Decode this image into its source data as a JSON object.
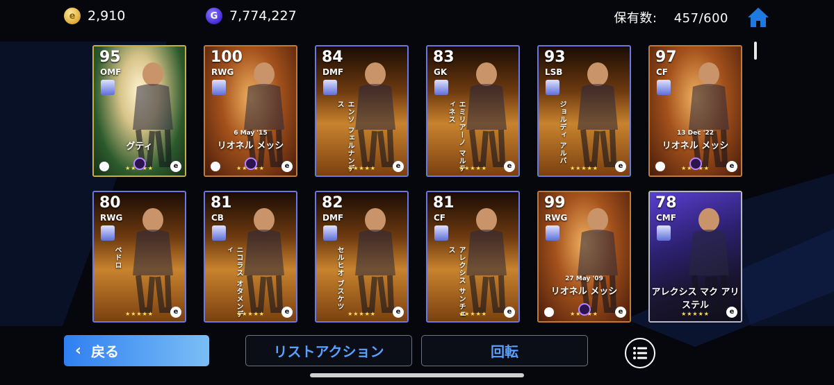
{
  "header": {
    "coins": "2,910",
    "coin_icon": "e-coin-icon",
    "gp": "7,774,227",
    "gp_icon": "gp-icon",
    "gp_letter": "G",
    "holdings_label": "保有数:",
    "holdings_value": "457/600",
    "home_icon": "home-icon",
    "accent": "#1f7ae0"
  },
  "cards": [
    {
      "rating": "95",
      "pos": "OMF",
      "name": "グティ",
      "name_dir": "h",
      "date": "",
      "stars": "★★★★★",
      "frame": "#c5b046",
      "bg": "green-gold"
    },
    {
      "rating": "100",
      "pos": "RWG",
      "name": "リオネル メッシ",
      "name_dir": "h",
      "date": "6 May '15",
      "stars": "★★★★★",
      "frame": "#c07b3a",
      "bg": "bronze"
    },
    {
      "rating": "84",
      "pos": "DMF",
      "name": "エンソ フェルナンデス",
      "name_dir": "v",
      "date": "",
      "stars": "★★★★★",
      "frame": "#6a78e0",
      "bg": "spotlight"
    },
    {
      "rating": "83",
      "pos": "GK",
      "name": "エミリアーノ マルティネス",
      "name_dir": "v",
      "date": "",
      "stars": "★★★★★",
      "frame": "#6a78e0",
      "bg": "spotlight"
    },
    {
      "rating": "93",
      "pos": "LSB",
      "name": "ジョルディ アルバ",
      "name_dir": "v",
      "date": "",
      "stars": "★★★★★",
      "frame": "#6a78e0",
      "bg": "spotlight"
    },
    {
      "rating": "97",
      "pos": "CF",
      "name": "リオネル メッシ",
      "name_dir": "h",
      "date": "13 Dec '22",
      "stars": "★★★★★",
      "frame": "#c07b3a",
      "bg": "bronze"
    },
    {
      "rating": "80",
      "pos": "RWG",
      "name": "ペドロ",
      "name_dir": "v",
      "date": "",
      "stars": "★★★★★",
      "frame": "#6a78e0",
      "bg": "spotlight"
    },
    {
      "rating": "81",
      "pos": "CB",
      "name": "ニコラス オタメンディ",
      "name_dir": "v",
      "date": "",
      "stars": "★★★★★",
      "frame": "#6a78e0",
      "bg": "spotlight"
    },
    {
      "rating": "82",
      "pos": "DMF",
      "name": "セルヒオ ブスケツ",
      "name_dir": "v",
      "date": "",
      "stars": "★★★★★",
      "frame": "#6a78e0",
      "bg": "spotlight"
    },
    {
      "rating": "81",
      "pos": "CF",
      "name": "アレクシス サンチェス",
      "name_dir": "v",
      "date": "",
      "stars": "★★★★★",
      "frame": "#6a78e0",
      "bg": "spotlight"
    },
    {
      "rating": "99",
      "pos": "RWG",
      "name": "リオネル メッシ",
      "name_dir": "h",
      "date": "27 May '09",
      "stars": "★★★★★",
      "frame": "#c07b3a",
      "bg": "bronze"
    },
    {
      "rating": "78",
      "pos": "CMF",
      "name": "アレクシス マク アリステル",
      "name_dir": "h",
      "date": "",
      "stars": "★★★★★",
      "frame": "#b8b8c8",
      "bg": "purple"
    }
  ],
  "footer": {
    "back_label": "戻る",
    "list_action_label": "リストアクション",
    "rotate_label": "回転",
    "list_icon": "list-icon"
  }
}
